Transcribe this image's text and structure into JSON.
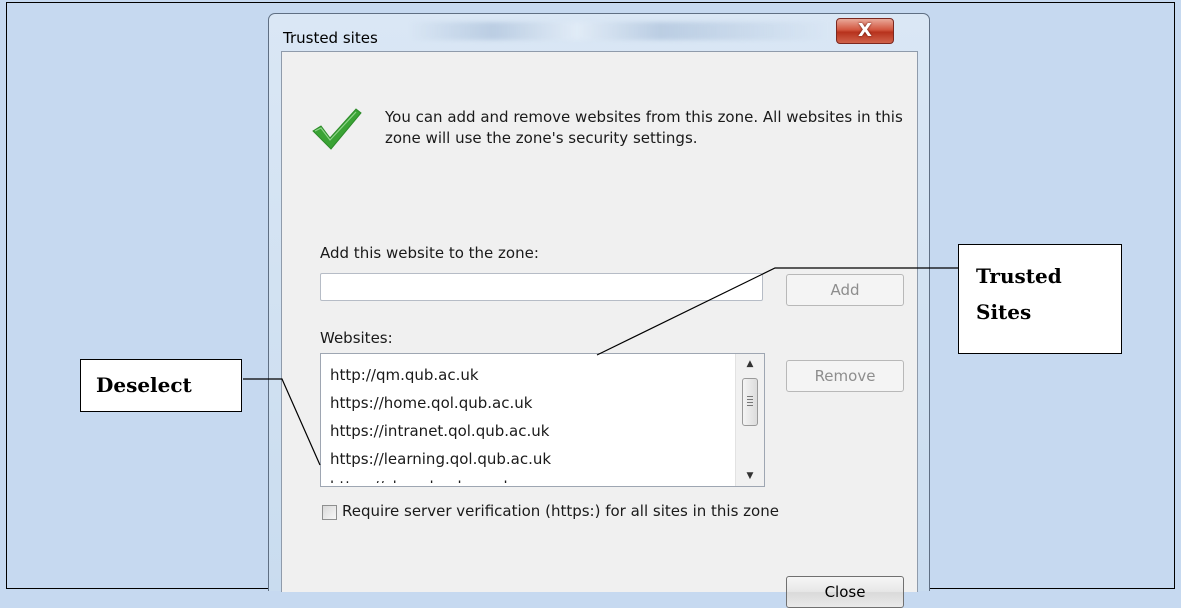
{
  "dialog": {
    "title": "Trusted sites",
    "close_glyph": "X",
    "info_text": "You can add and remove websites from this zone. All websites in this zone will use the zone's security settings.",
    "add_label": "Add this website to the zone:",
    "add_input_value": "",
    "add_button": "Add",
    "websites_label": "Websites:",
    "websites": [
      "http://qm.qub.ac.uk",
      "https://home.qol.qub.ac.uk",
      "https://intranet.qol.qub.ac.uk",
      "https://learning.qol.qub.ac.uk",
      "https://vle.qol.qub.ac.uk"
    ],
    "remove_button": "Remove",
    "require_verification_label": "Require server verification (https:) for all sites in this zone",
    "require_verification_checked": false,
    "close_button": "Close"
  },
  "callouts": {
    "deselect": "Deselect",
    "trusted_sites_line1": "Trusted",
    "trusted_sites_line2": "Sites"
  },
  "colors": {
    "page_background": "#c6d9f0",
    "dialog_client": "#f0f0f0",
    "check_green": "#3aa335",
    "close_button_red": "#c9452e"
  },
  "icons": [
    "green-checkmark-icon",
    "scroll-up-arrow-icon",
    "scroll-down-arrow-icon"
  ]
}
